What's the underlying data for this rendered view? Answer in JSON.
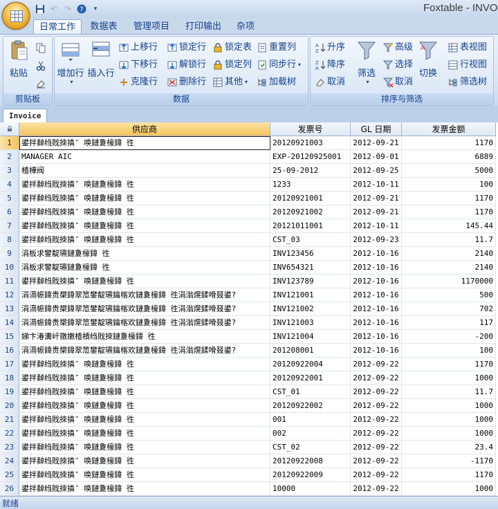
{
  "app": {
    "title": "Foxtable - INVOICE"
  },
  "quick_access": {
    "icons": [
      "save-icon",
      "undo-icon",
      "redo-icon",
      "help-icon",
      "dropdown-icon"
    ]
  },
  "ribbon_tabs": [
    "日常工作",
    "数据表",
    "管理项目",
    "打印输出",
    "杂项"
  ],
  "ribbon": {
    "clipboard": {
      "label": "剪贴板",
      "paste": "粘贴"
    },
    "data": {
      "label": "数据",
      "add_row": "增加行",
      "insert_row": "插入行",
      "move_up": "上移行",
      "move_down": "下移行",
      "clone_row": "克隆行",
      "lock_row": "锁定行",
      "unlock_row": "解锁行",
      "delete_row": "删除行",
      "lock_table": "锁定表",
      "lock_column": "锁定列",
      "other": "其他",
      "reset_column": "重置列",
      "sync_row": "同步行",
      "load_tree": "加载树"
    },
    "sort": {
      "label": "排序与筛选",
      "asc": "升序",
      "desc": "降序",
      "cancel": "取消",
      "filter": "筛选",
      "advanced": "高级",
      "select": "选择",
      "cancel2": "取消",
      "switch": "切换",
      "table_view": "表视图",
      "row_view": "行视图",
      "filter_tree": "筛选树"
    }
  },
  "sheet_tab": "Invoice",
  "table": {
    "columns": [
      "供应商",
      "发票号",
      "GL 日期",
      "发票金额"
    ],
    "rows": [
      [
        "1",
        "鍙拌繛绉戝拺搷″ 唤鏈夐檺鍏 徃",
        "20120921003",
        "2012-09-21",
        "1170"
      ],
      [
        "2",
        "MANAGER AIC",
        "EXP-20120925001",
        "2012-09-01",
        "6889"
      ],
      [
        "3",
        "楂樺阀",
        "25-09-2012",
        "2012-09-25",
        "5000"
      ],
      [
        "4",
        "鍙拌繛绉戝拺搷″ 唤鏈夐檺鍏 徃",
        "1233",
        "2012-10-11",
        "100"
      ],
      [
        "5",
        "鍙拌繛绉戝拺搷″ 唤鏈夐檺鍏 徃",
        "20120921001",
        "2012-09-21",
        "1170"
      ],
      [
        "6",
        "鍙拌繛绉戝拺搷″ 唤鏈夐檺鍏 徃",
        "20120921002",
        "2012-09-21",
        "1170"
      ],
      [
        "7",
        "鍙拌繛绉戝拺搷″ 唤鏈夐檺鍏 徃",
        "20121011001",
        "2012-10-11",
        "145.44"
      ],
      [
        "8",
        "鍙拌繛绉戝拺搷″ 唤鏈夐檺鍏 徃",
        "CST_03",
        "2012-09-23",
        "11.7"
      ],
      [
        "9",
        "涓板求鐢靛瓙鏈夐檺鍏 徃",
        "INV123456",
        "2012-10-16",
        "2140"
      ],
      [
        "10",
        "涓板求鐢靛瓙鏈夐檺鍏 徃",
        "INV654321",
        "2012-10-16",
        "2140"
      ],
      [
        "11",
        "鍙拌繛绉戝拺搷″ 唤鏈夐檺鍏 徃",
        "INV123789",
        "2012-10-16",
        "1170000"
      ],
      [
        "12",
        "涓滆帪鍏贵槼鍏翠笟鐢靛瓙鑰楁欢鏈夐檺鍏 徃涓滃熀鍒嗗叕鍙?",
        "INV121001",
        "2012-10-16",
        "500"
      ],
      [
        "13",
        "涓滆帪鍏贵槼鍏翠笟鐢靛瓙鑰楁欢鏈夐檺鍏 徃涓滃熀鍒嗗叕鍙?",
        "INV121002",
        "2012-10-16",
        "702"
      ],
      [
        "14",
        "涓滆帪鍏贵槼鍏翠笟鐢靛瓙鑰楁欢鏈夐檺鍏 徃涓滃熀鍒嗗叕鍙?",
        "INV121003",
        "2012-10-16",
        "117"
      ],
      [
        "15",
        "娣卞湷瀵屽獤嫩楂樻绉戝拺鏈夐檺鍏 徃",
        "INV121004",
        "2012-10-16",
        "-200"
      ],
      [
        "16",
        "涓滆帪鍏贵槼鍏翠笟鐢靛瓙鑰楁欢鏈夐檺鍏 徃涓滃熀鍒嗗叕鍙?",
        "201208001",
        "2012-10-16",
        "100"
      ],
      [
        "17",
        "鍙拌繛绉戝拺搷″ 唤鏈夐檺鍏 徃",
        "20120922004",
        "2012-09-22",
        "1170"
      ],
      [
        "18",
        "鍙拌繛绉戝拺搷″ 唤鏈夐檺鍏 徃",
        "20120922001",
        "2012-09-22",
        "1000"
      ],
      [
        "19",
        "鍙拌繛绉戝拺搷″ 唤鏈夐檺鍏 徃",
        "CST_01",
        "2012-09-22",
        "11.7"
      ],
      [
        "20",
        "鍙拌繛绉戝拺搷″ 唤鏈夐檺鍏 徃",
        "20120922002",
        "2012-09-22",
        "1000"
      ],
      [
        "21",
        "鍙拌繛绉戝拺搷″ 唤鏈夐檺鍏 徃",
        "001",
        "2012-09-22",
        "1000"
      ],
      [
        "22",
        "鍙拌繛绉戝拺搷″ 唤鏈夐檺鍏 徃",
        "002",
        "2012-09-22",
        "1000"
      ],
      [
        "23",
        "鍙拌繛绉戝拺搷″ 唤鏈夐檺鍏 徃",
        "CST_02",
        "2012-09-22",
        "23.4"
      ],
      [
        "24",
        "鍙拌繛绉戝拺搷″ 唤鏈夐檺鍏 徃",
        "20120922008",
        "2012-09-22",
        "-1170"
      ],
      [
        "25",
        "鍙拌繛绉戝拺搷″ 唤鏈夐檺鍏 徃",
        "20120922009",
        "2012-09-22",
        "1170"
      ],
      [
        "26",
        "鍙拌繛绉戝拺搷″ 唤鏈夐檺鍏 徃",
        "10000",
        "2012-09-22",
        "1000"
      ]
    ]
  },
  "status": {
    "text": "就绪"
  }
}
